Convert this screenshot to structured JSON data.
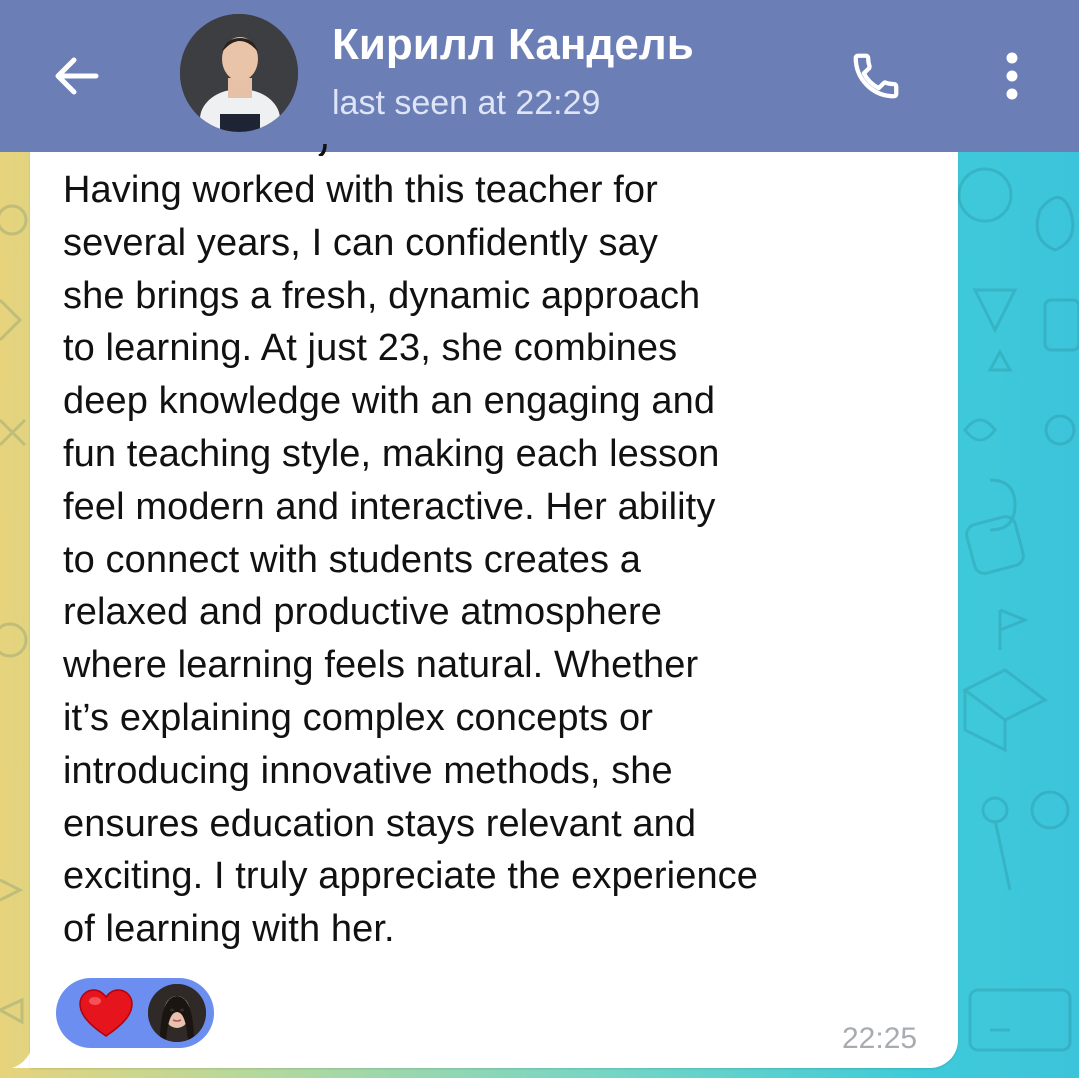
{
  "header": {
    "contact_name": "Кирилл Кандель",
    "status": "last seen at 22:29",
    "back_icon": "arrow-left-icon",
    "call_icon": "phone-icon",
    "menu_icon": "more-vertical-icon",
    "background_color": "#6b7fb6"
  },
  "message": {
    "text": "Having worked with this teacher for\nseveral years, I can confidently say\nshe brings a fresh, dynamic approach\nto learning. At just 23, she combines\ndeep knowledge with an engaging and\nfun teaching style, making each lesson\nfeel modern and interactive. Her ability\nto connect with students creates a\nrelaxed and productive atmosphere\nwhere learning feels natural. Whether\nit’s explaining complex concepts or\nintroducing innovative methods, she\nensures education stays relevant and\nexciting. I truly appreciate the experience\nof learning with her.",
    "time": "22:25",
    "reaction": {
      "emoji_icon": "red-heart-icon",
      "reactor_icon": "reactor-avatar",
      "pill_color": "#6b8ef0"
    }
  }
}
